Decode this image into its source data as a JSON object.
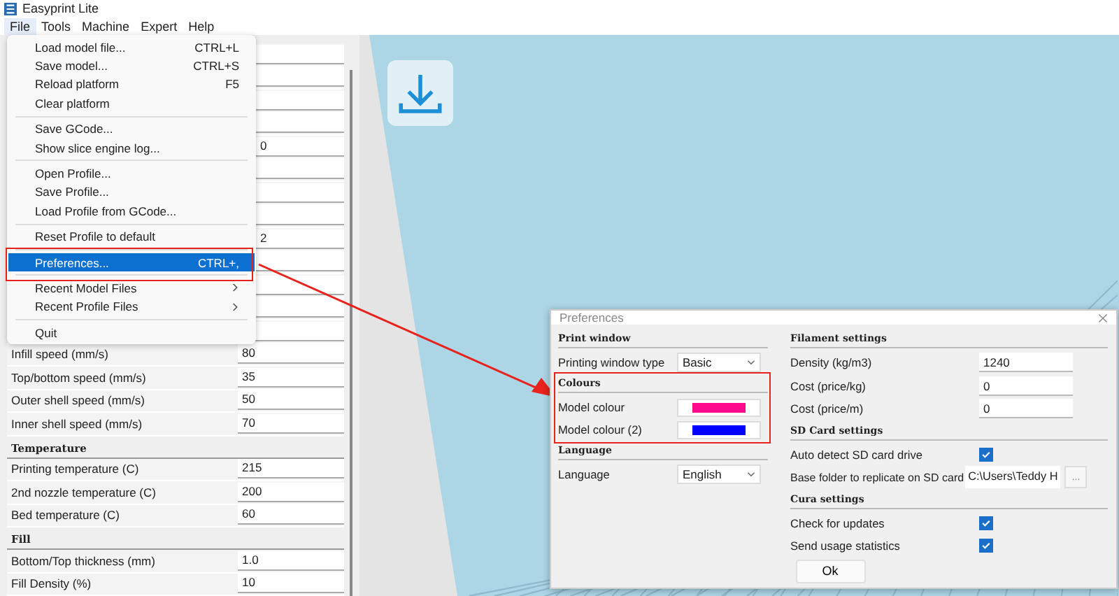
{
  "window": {
    "title": "Easyprint Lite"
  },
  "menubar": [
    {
      "label": "File",
      "selected": true
    },
    {
      "label": "Tools",
      "selected": false
    },
    {
      "label": "Machine",
      "selected": false
    },
    {
      "label": "Expert",
      "selected": false
    },
    {
      "label": "Help",
      "selected": false
    }
  ],
  "settings_panel": {
    "covered_rows": [
      {},
      {},
      {},
      {},
      {
        "value": "0"
      },
      {},
      {},
      {},
      {
        "value": "2"
      },
      {},
      {},
      {},
      {}
    ],
    "sections": [
      {
        "rows": [
          {
            "label": "Infill speed (mm/s)",
            "value": "80"
          },
          {
            "label": "Top/bottom speed (mm/s)",
            "value": "35"
          },
          {
            "label": "Outer shell speed (mm/s)",
            "value": "50"
          },
          {
            "label": "Inner shell speed (mm/s)",
            "value": "70"
          }
        ]
      },
      {
        "heading": "Temperature",
        "rows": [
          {
            "label": "Printing temperature (C)",
            "value": "215"
          },
          {
            "label": "2nd nozzle temperature (C)",
            "value": "200"
          },
          {
            "label": "Bed temperature (C)",
            "value": "60"
          }
        ]
      },
      {
        "heading": "Fill",
        "rows": [
          {
            "label": "Bottom/Top thickness (mm)",
            "value": "1.0"
          },
          {
            "label": "Fill Density (%)",
            "value": "10"
          }
        ]
      }
    ]
  },
  "file_menu": [
    {
      "kind": "item",
      "label": "Load model file...",
      "shortcut": "CTRL+L",
      "selected": false
    },
    {
      "kind": "item",
      "label": "Save model...",
      "shortcut": "CTRL+S",
      "selected": false
    },
    {
      "kind": "item",
      "label": "Reload platform",
      "shortcut": "F5",
      "selected": false
    },
    {
      "kind": "item",
      "label": "Clear platform",
      "selected": false
    },
    {
      "kind": "separator"
    },
    {
      "kind": "item",
      "label": "Save GCode...",
      "selected": false
    },
    {
      "kind": "item",
      "label": "Show slice engine log...",
      "selected": false
    },
    {
      "kind": "separator"
    },
    {
      "kind": "item",
      "label": "Open Profile...",
      "selected": false
    },
    {
      "kind": "item",
      "label": "Save Profile...",
      "selected": false
    },
    {
      "kind": "item",
      "label": "Load Profile from GCode...",
      "selected": false
    },
    {
      "kind": "separator"
    },
    {
      "kind": "item",
      "label": "Reset Profile to default",
      "selected": false
    },
    {
      "kind": "separator"
    },
    {
      "kind": "item",
      "label": "Preferences...",
      "shortcut": "CTRL+,",
      "selected": true,
      "highlighted_frame": true
    },
    {
      "kind": "separator"
    },
    {
      "kind": "submenu",
      "label": "Recent Model Files",
      "selected": false
    },
    {
      "kind": "submenu",
      "label": "Recent Profile Files",
      "selected": false
    },
    {
      "kind": "separator"
    },
    {
      "kind": "item",
      "label": "Quit",
      "selected": false
    }
  ],
  "preferences_dialog": {
    "title": "Preferences",
    "left": [
      {
        "heading": "Print window",
        "rows": [
          {
            "kind": "select",
            "label": "Printing window type",
            "value": "Basic"
          }
        ]
      },
      {
        "heading": "Colours",
        "highlighted_frame": true,
        "rows": [
          {
            "kind": "colour",
            "label": "Model colour",
            "color": "#ff0a8c"
          },
          {
            "kind": "colour",
            "label": "Model colour (2)",
            "color": "#0000ff"
          }
        ]
      },
      {
        "heading": "Language",
        "rows": [
          {
            "kind": "select",
            "label": "Language",
            "value": "English"
          }
        ]
      }
    ],
    "right": [
      {
        "heading": "Filament settings",
        "rows": [
          {
            "kind": "text",
            "label": "Density (kg/m3)",
            "value": "1240"
          },
          {
            "kind": "text",
            "label": "Cost (price/kg)",
            "value": "0"
          },
          {
            "kind": "text",
            "label": "Cost (price/m)",
            "value": "0"
          }
        ]
      },
      {
        "heading": "SD Card settings",
        "rows": [
          {
            "kind": "check",
            "label": "Auto detect SD card drive",
            "checked": true
          },
          {
            "kind": "path",
            "label": "Base folder to replicate on SD card",
            "value": "C:\\Users\\Teddy H",
            "button": "..."
          }
        ]
      },
      {
        "heading": "Cura settings",
        "rows": [
          {
            "kind": "check",
            "label": "Check for updates",
            "checked": true
          },
          {
            "kind": "check",
            "label": "Send usage statistics",
            "checked": true
          }
        ]
      }
    ],
    "ok_button": "Ok"
  }
}
